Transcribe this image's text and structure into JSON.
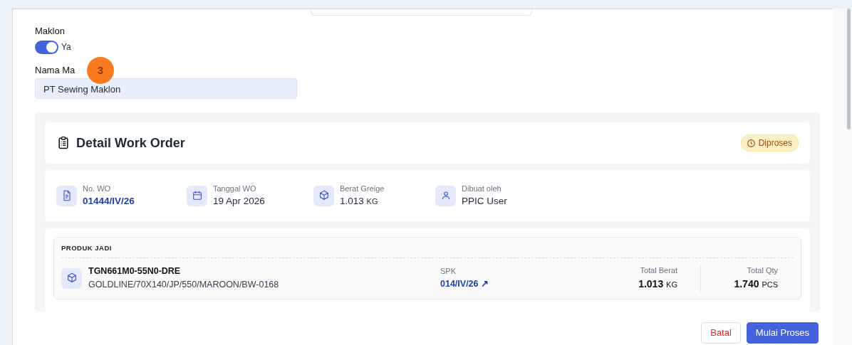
{
  "maklon": {
    "label": "Maklon",
    "on": true,
    "text": "Ya"
  },
  "nama_maklon": {
    "label": "Nama Ma",
    "value": "PT Sewing Maklon"
  },
  "step_marker": "3",
  "work_order": {
    "title": "Detail Work Order",
    "status": "Diproses",
    "info": [
      {
        "kind": "document",
        "label": "No. WO",
        "value": "01444/IV/26",
        "link": true
      },
      {
        "kind": "calendar",
        "label": "Tanggal WO",
        "value": "19 Apr 2026",
        "link": false
      },
      {
        "kind": "box",
        "label": "Berat Greige",
        "value": "1.013",
        "unit": "KG",
        "link": false
      },
      {
        "kind": "user",
        "label": "Dibuat oleh",
        "value": "PPIC User",
        "link": false
      }
    ],
    "produk": {
      "heading": "PRODUK JADI",
      "code": "TGN661M0-55N0-DRE",
      "description": "GOLDLINE/70X140/JP/550/MAROON/BW-0168",
      "spk_label": "SPK",
      "spk_value": "014/IV/26",
      "spk_arrow": "↗",
      "totals": [
        {
          "label": "Total Berat",
          "value": "1.013",
          "unit": "KG"
        },
        {
          "label": "Total Qty",
          "value": "1.740",
          "unit": "PCS"
        }
      ]
    }
  },
  "buttons": [
    {
      "kind": "cancel",
      "label": "Batal"
    },
    {
      "kind": "primary",
      "label": "Mulai Proses"
    }
  ]
}
